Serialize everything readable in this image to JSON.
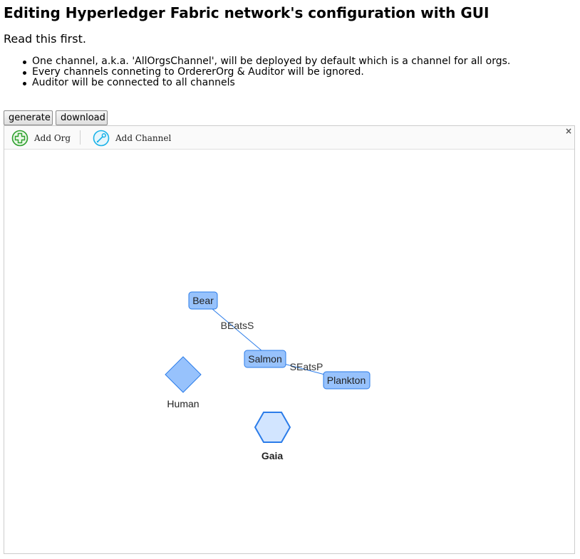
{
  "page": {
    "title": "Editing Hyperledger Fabric network's configuration with GUI",
    "intro": "Read this first.",
    "notes": [
      "One channel, a.k.a. 'AllOrgsChannel', will be deployed by default which is a channel for all orgs.",
      "Every channels conneting to OrdererOrg & Auditor will be ignored.",
      "Auditor will be connected to all channels"
    ]
  },
  "buttons": {
    "generate": "generate",
    "download": "download"
  },
  "toolbar": {
    "add_org": "Add Org",
    "add_channel": "Add Channel",
    "close": "×"
  },
  "network": {
    "nodes": {
      "bear": "Bear",
      "salmon": "Salmon",
      "plankton": "Plankton",
      "human": "Human",
      "gaia": "Gaia"
    },
    "edges": {
      "bear_salmon": "BEatsS",
      "salmon_plankton": "SEatsP"
    }
  },
  "colors": {
    "org_fill": "#97c2fc",
    "org_border": "#2b7ce9",
    "gaia_fill": "#d2e5ff",
    "edge": "#2b7ce9",
    "add_org_icon": "#2ca02c",
    "add_channel_icon": "#1ab2e8"
  }
}
